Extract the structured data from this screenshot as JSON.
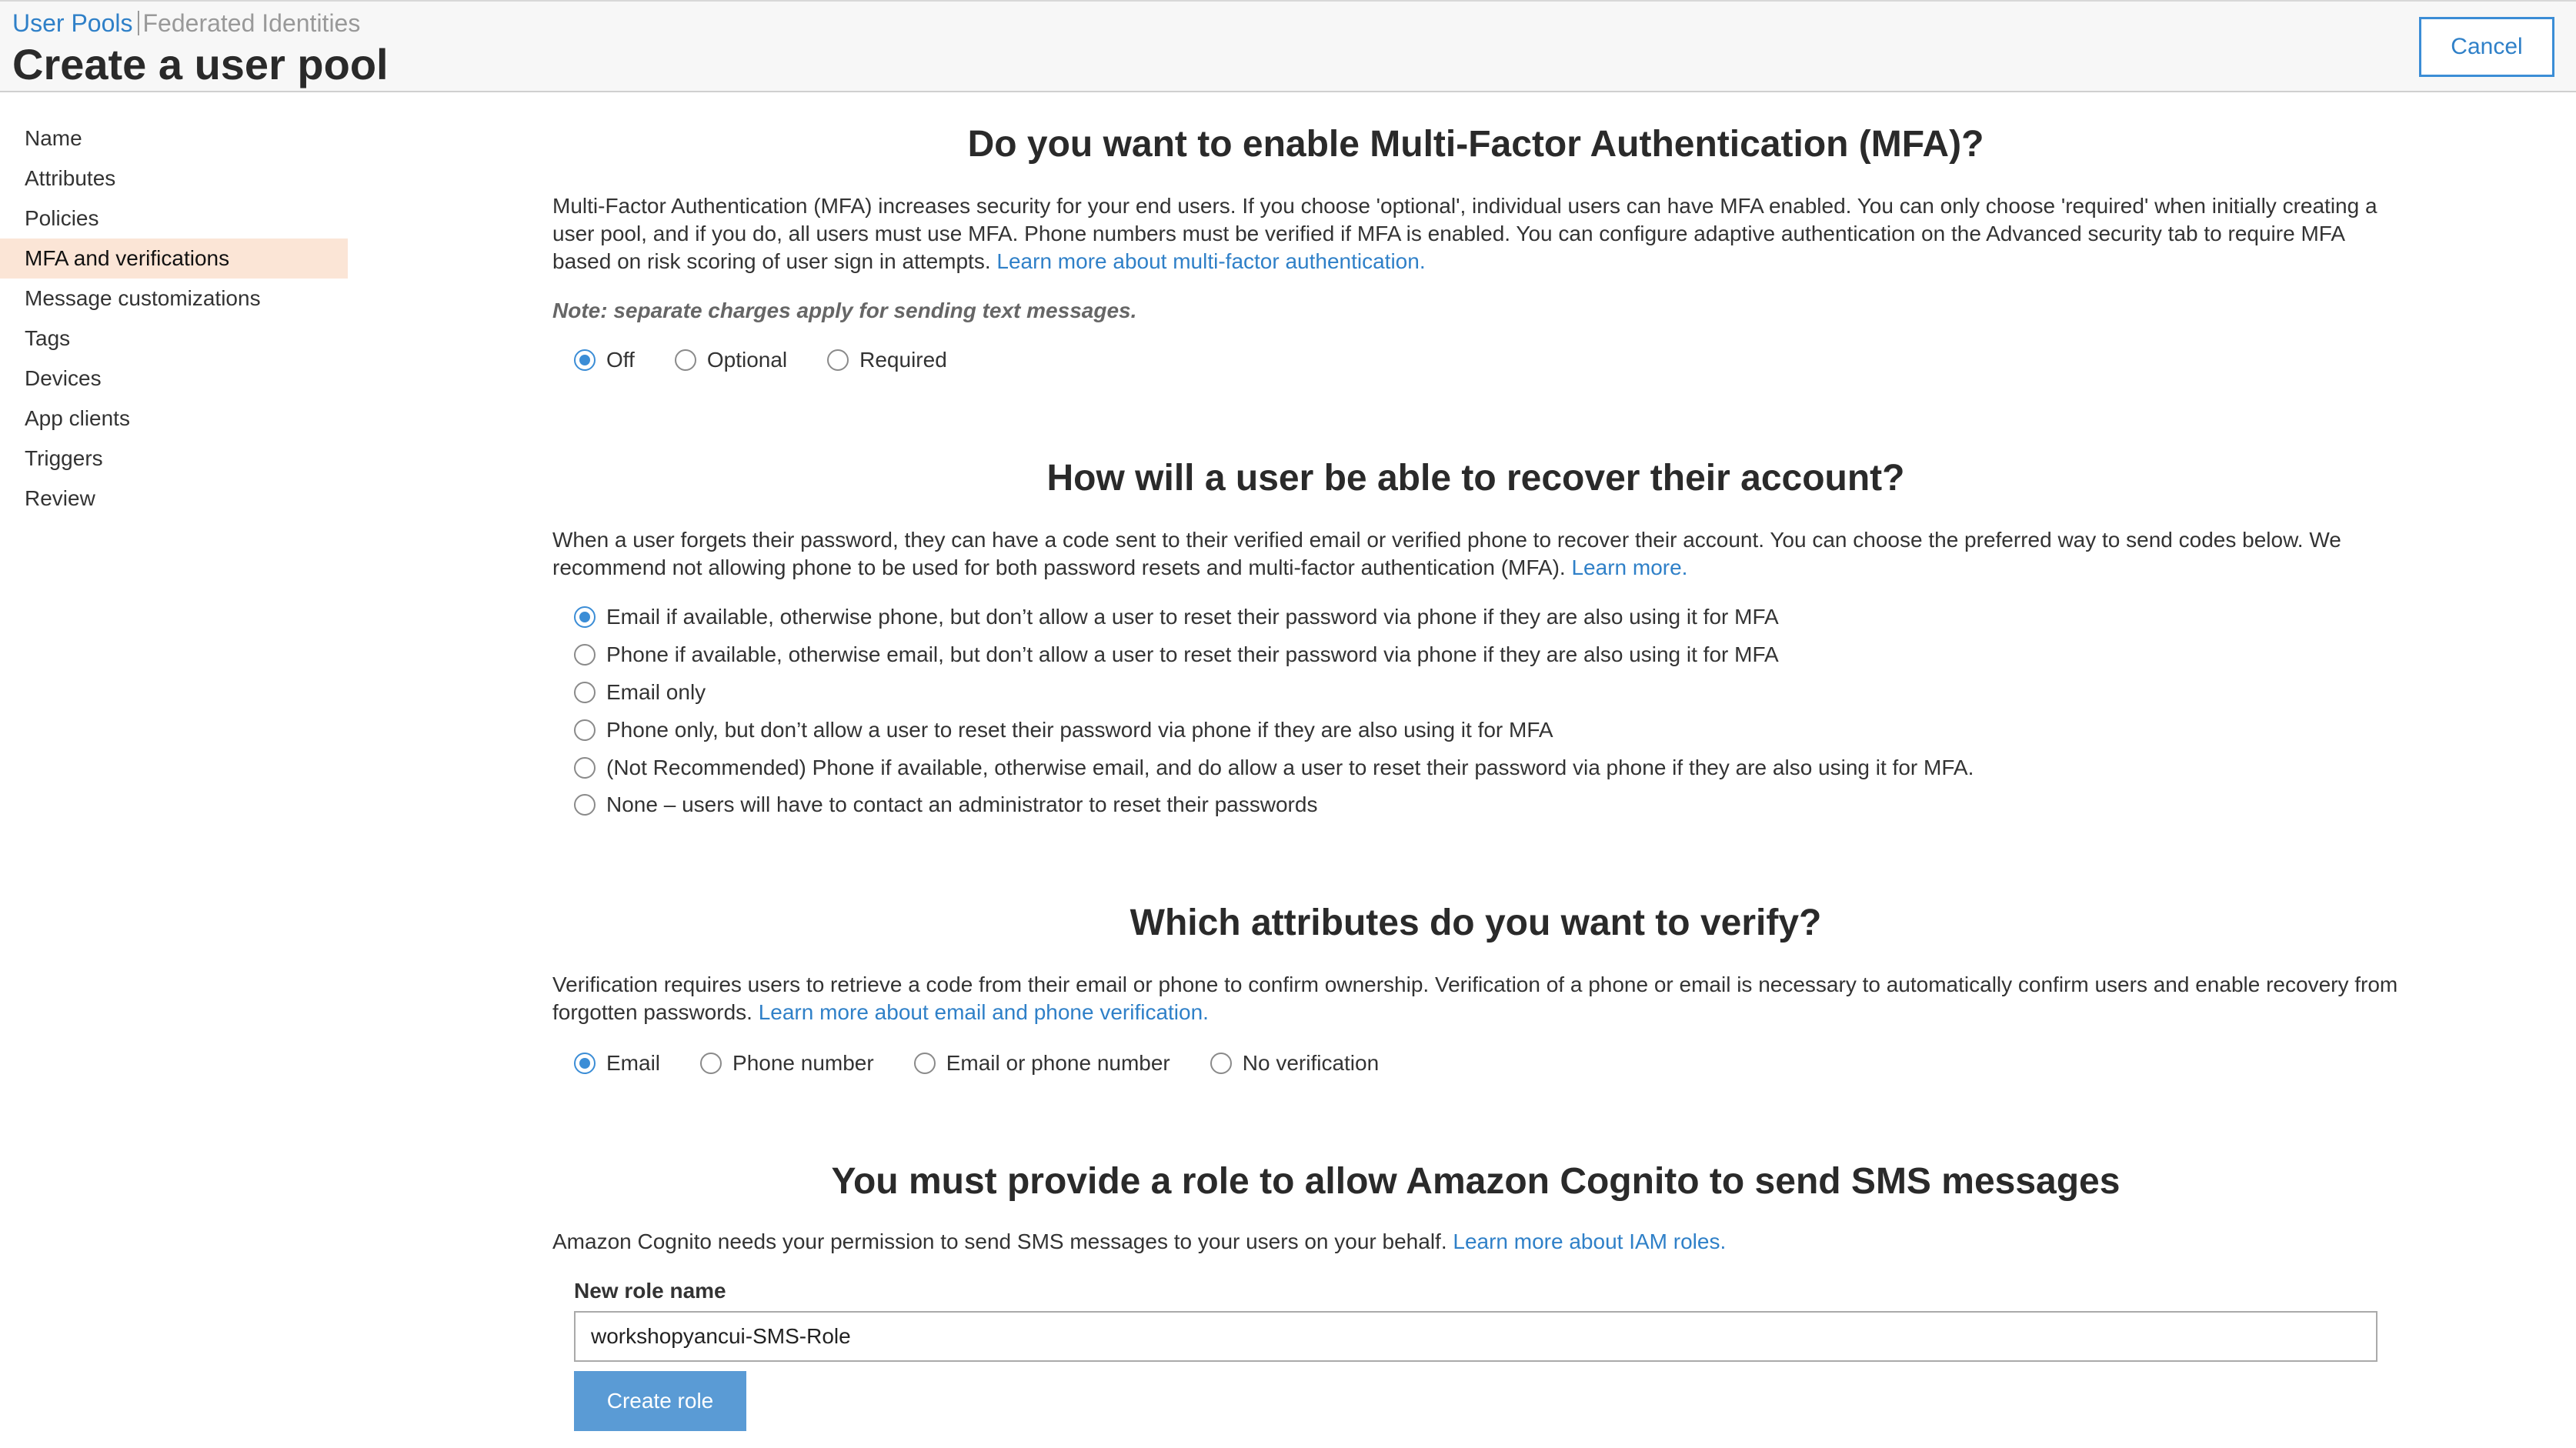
{
  "header": {
    "breadcrumb_active": "User Pools",
    "breadcrumb_inactive": "Federated Identities",
    "title": "Create a user pool",
    "cancel_label": "Cancel"
  },
  "sidebar": {
    "items": [
      {
        "label": "Name"
      },
      {
        "label": "Attributes"
      },
      {
        "label": "Policies"
      },
      {
        "label": "MFA and verifications",
        "active": true
      },
      {
        "label": "Message customizations"
      },
      {
        "label": "Tags"
      },
      {
        "label": "Devices"
      },
      {
        "label": "App clients"
      },
      {
        "label": "Triggers"
      },
      {
        "label": "Review"
      }
    ]
  },
  "mfa": {
    "title": "Do you want to enable Multi-Factor Authentication (MFA)?",
    "description": "Multi-Factor Authentication (MFA) increases security for your end users. If you choose 'optional', individual users can have MFA enabled. You can only choose 'required' when initially creating a user pool, and if you do, all users must use MFA. Phone numbers must be verified if MFA is enabled. You can configure adaptive authentication on the Advanced security tab to require MFA based on risk scoring of user sign in attempts.",
    "link": "Learn more about multi-factor authentication.",
    "note": "Note: separate charges apply for sending text messages.",
    "options": [
      "Off",
      "Optional",
      "Required"
    ],
    "selected": "Off"
  },
  "recovery": {
    "title": "How will a user be able to recover their account?",
    "description": "When a user forgets their password, they can have a code sent to their verified email or verified phone to recover their account. You can choose the preferred way to send codes below. We recommend not allowing phone to be used for both password resets and multi-factor authentication (MFA).",
    "link": "Learn more.",
    "options": [
      "Email if available, otherwise phone, but don’t allow a user to reset their password via phone if they are also using it for MFA",
      "Phone if available, otherwise email, but don’t allow a user to reset their password via phone if they are also using it for MFA",
      "Email only",
      "Phone only, but don’t allow a user to reset their password via phone if they are also using it for MFA",
      "(Not Recommended) Phone if available, otherwise email, and do allow a user to reset their password via phone if they are also using it for MFA.",
      "None – users will have to contact an administrator to reset their passwords"
    ],
    "selected_index": 0
  },
  "verify": {
    "title": "Which attributes do you want to verify?",
    "description": "Verification requires users to retrieve a code from their email or phone to confirm ownership. Verification of a phone or email is necessary to automatically confirm users and enable recovery from forgotten passwords.",
    "link": "Learn more about email and phone verification.",
    "options": [
      "Email",
      "Phone number",
      "Email or phone number",
      "No verification"
    ],
    "selected": "Email"
  },
  "sms_role": {
    "title": "You must provide a role to allow Amazon Cognito to send SMS messages",
    "description": "Amazon Cognito needs your permission to send SMS messages to your users on your behalf.",
    "link": "Learn more about IAM roles.",
    "field_label": "New role name",
    "role_name_value": "workshopyancui-SMS-Role",
    "create_label": "Create role"
  },
  "colors": {
    "accent": "#3b8dd6",
    "link": "#2f80c8",
    "sidebar_active_bg": "#fbe5d6"
  }
}
